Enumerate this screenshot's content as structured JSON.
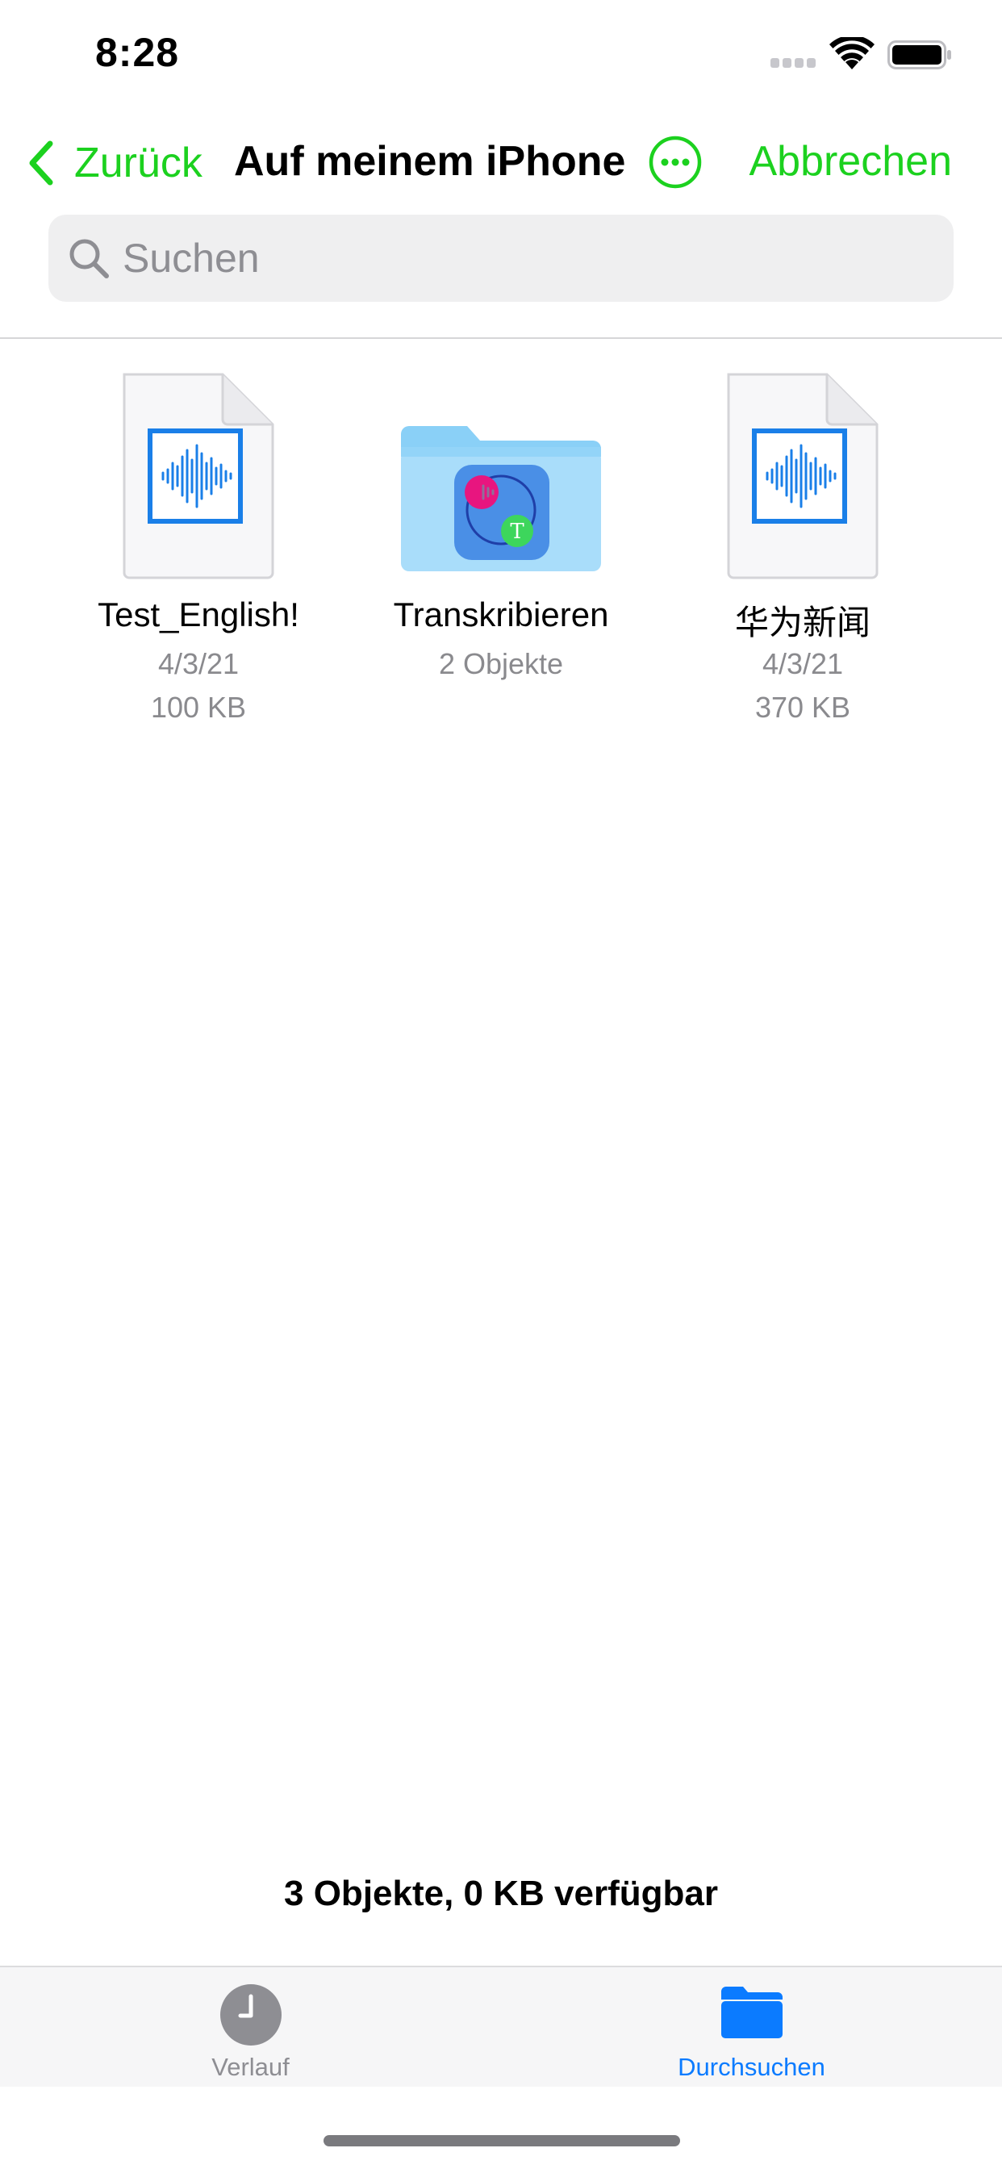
{
  "status_bar": {
    "time": "8:28"
  },
  "nav": {
    "back_label": "Zurück",
    "title": "Auf meinem iPhone",
    "cancel_label": "Abbrechen",
    "accent_color": "#1cd11f"
  },
  "search": {
    "placeholder": "Suchen",
    "value": ""
  },
  "files": [
    {
      "name": "Test_English!",
      "meta1": "4/3/21",
      "meta2": "100 KB",
      "icon": "audio-file-icon"
    },
    {
      "name": "Transkribieren",
      "meta1": "2 Objekte",
      "meta2": "",
      "icon": "folder-icon"
    },
    {
      "name": "华为新闻",
      "meta1": "4/3/21",
      "meta2": "370 KB",
      "icon": "audio-file-icon"
    }
  ],
  "footer": {
    "summary": "3 Objekte, 0 KB verfügbar"
  },
  "tabs": [
    {
      "label": "Verlauf",
      "icon": "clock-icon",
      "selected": false
    },
    {
      "label": "Durchsuchen",
      "icon": "folder-icon",
      "selected": true
    }
  ]
}
